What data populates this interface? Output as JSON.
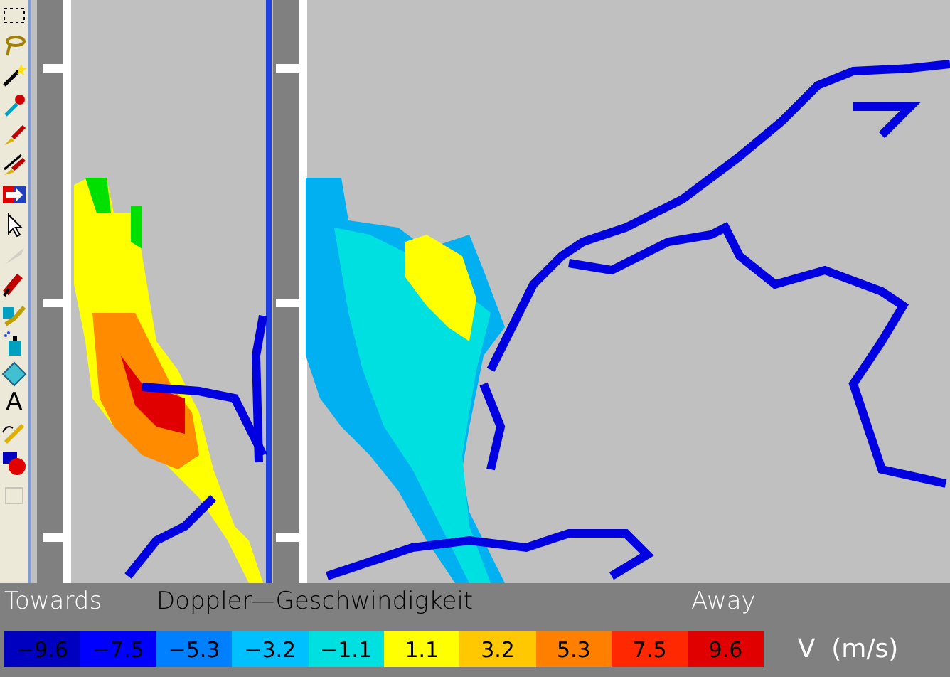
{
  "toolbar": [
    {
      "kind": "select",
      "disabled": false
    },
    {
      "kind": "lasso",
      "disabled": false
    },
    {
      "kind": "wand",
      "disabled": false
    },
    {
      "kind": "dropper",
      "disabled": false
    },
    {
      "kind": "brush",
      "disabled": false
    },
    {
      "kind": "brushes",
      "disabled": false
    },
    {
      "kind": "swap",
      "disabled": false
    },
    {
      "kind": "pointer",
      "disabled": false
    },
    {
      "kind": "knife",
      "disabled": true
    },
    {
      "kind": "marker",
      "disabled": false
    },
    {
      "kind": "fill",
      "disabled": false
    },
    {
      "kind": "spray",
      "disabled": false
    },
    {
      "kind": "diamond",
      "disabled": false
    },
    {
      "kind": "text",
      "label": "A",
      "disabled": false
    },
    {
      "kind": "pencil",
      "disabled": false
    },
    {
      "kind": "shapes",
      "disabled": false
    },
    {
      "kind": "stamp",
      "disabled": true
    }
  ],
  "legend": {
    "towards": "Towards",
    "title": "Doppler—Geschwindigkeit",
    "away": "Away",
    "unit": "V  (m/s)",
    "scale": [
      {
        "value": "−9.6",
        "color": "#0000c0"
      },
      {
        "value": "−7.5",
        "color": "#0000ff"
      },
      {
        "value": "−5.3",
        "color": "#0080ff"
      },
      {
        "value": "−3.2",
        "color": "#00c0ff"
      },
      {
        "value": "−1.1",
        "color": "#00e0e0"
      },
      {
        "value": "1.1",
        "color": "#ffff00"
      },
      {
        "value": "3.2",
        "color": "#ffc800"
      },
      {
        "value": "5.3",
        "color": "#ff8000"
      },
      {
        "value": "7.5",
        "color": "#ff2800"
      },
      {
        "value": "9.6",
        "color": "#e00000"
      }
    ]
  }
}
